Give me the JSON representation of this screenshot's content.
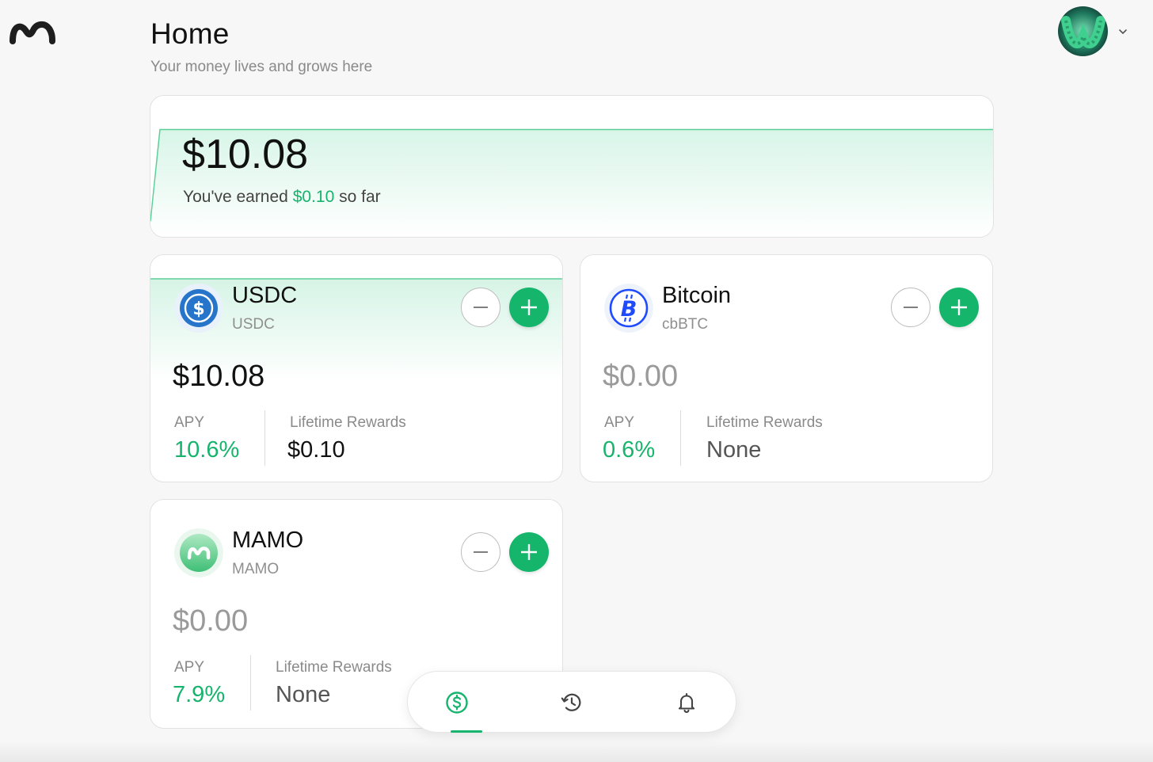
{
  "header": {
    "title": "Home",
    "subtitle": "Your money lives and grows here"
  },
  "balance": {
    "amount": "$10.08",
    "earned_prefix": "You've earned",
    "earned_amount": "$0.10",
    "earned_suffix": "so far"
  },
  "assets": [
    {
      "name": "USDC",
      "symbol": "USDC",
      "value": "$10.08",
      "apy_label": "APY",
      "apy": "10.6%",
      "rewards_label": "Lifetime Rewards",
      "rewards": "$0.10"
    },
    {
      "name": "Bitcoin",
      "symbol": "cbBTC",
      "value": "$0.00",
      "apy_label": "APY",
      "apy": "0.6%",
      "rewards_label": "Lifetime Rewards",
      "rewards": "None"
    },
    {
      "name": "MAMO",
      "symbol": "MAMO",
      "value": "$0.00",
      "apy_label": "APY",
      "apy": "7.9%",
      "rewards_label": "Lifetime Rewards",
      "rewards": "None"
    }
  ],
  "icons": {
    "logo": "mamo-logo-icon",
    "usdc": "usdc-coin-icon",
    "bitcoin": "bitcoin-coin-icon",
    "mamo": "mamo-coin-icon",
    "withdraw": "minus-icon",
    "deposit": "plus-icon",
    "nav_home": "dollar-circle-icon",
    "nav_history": "history-icon",
    "nav_notifications": "bell-icon",
    "avatar_menu": "chevron-down-icon"
  },
  "colors": {
    "accent": "#16b46c",
    "usdc_blue": "#2775ca",
    "bitcoin_blue": "#1f4bff"
  }
}
